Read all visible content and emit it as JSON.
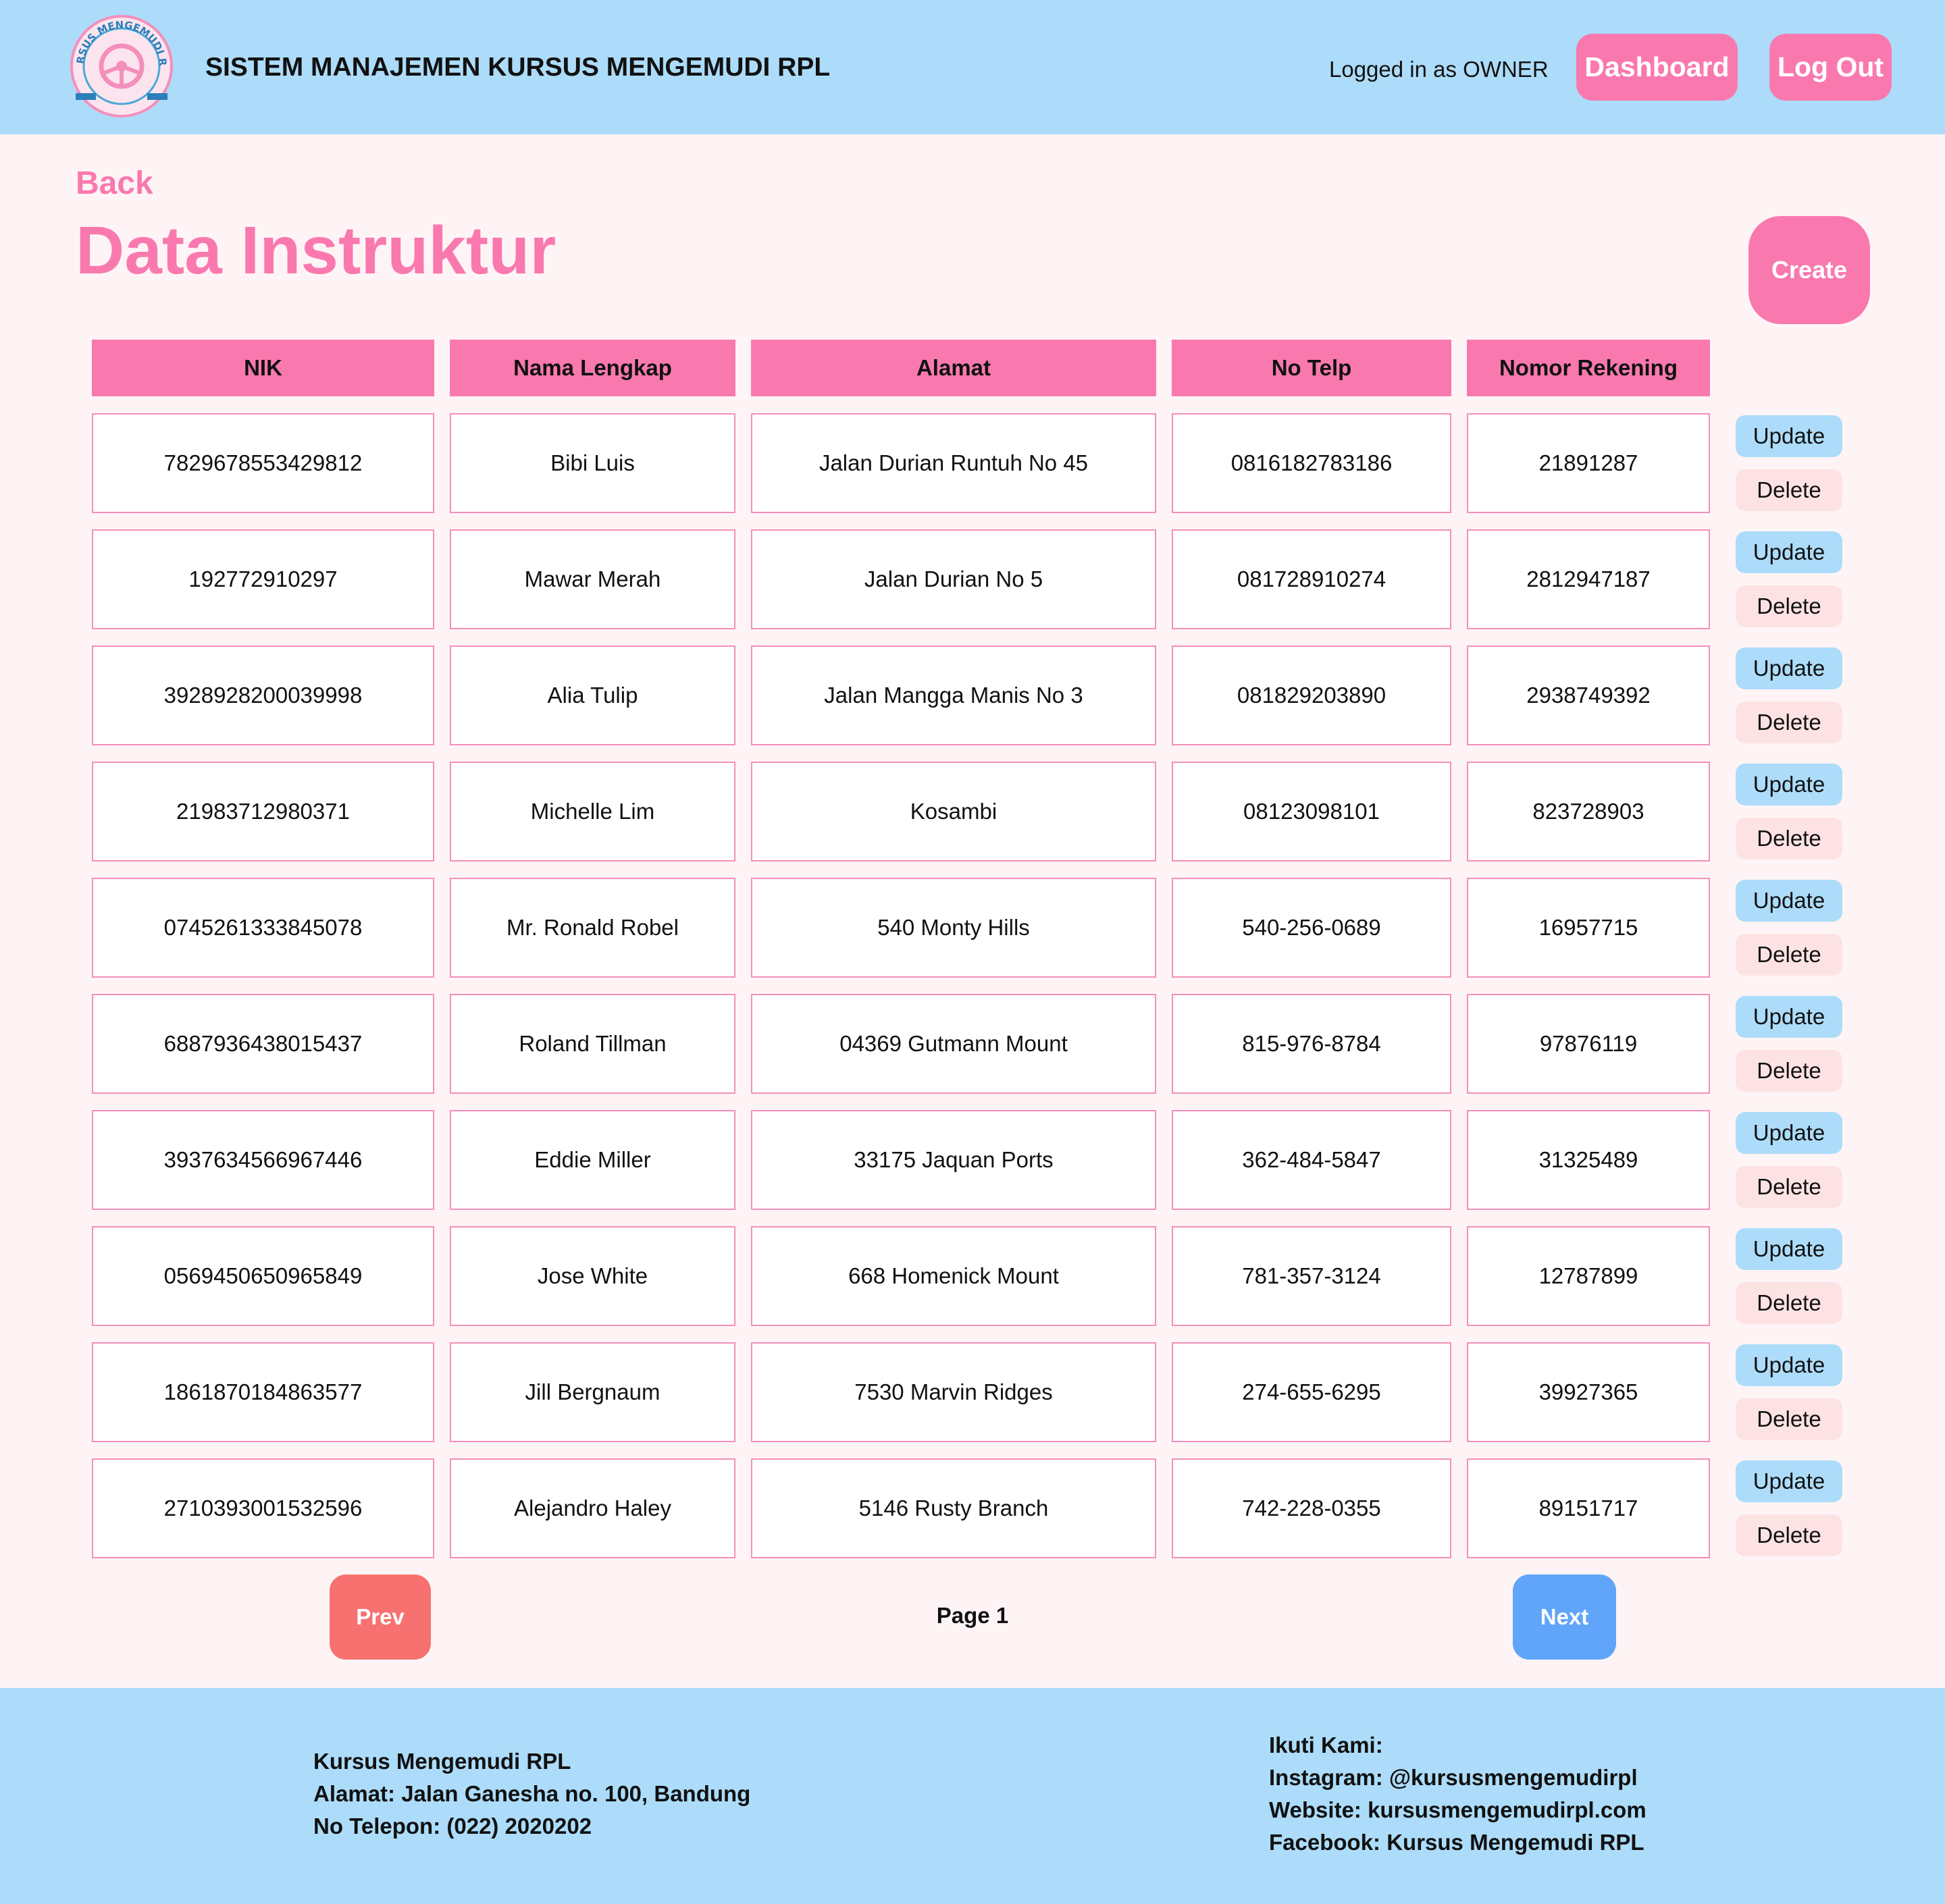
{
  "header": {
    "brand_title": "SISTEM MANAJEMEN KURSUS MENGEMUDI RPL",
    "logo_text": "KURSUS MENGEMUDI RPL",
    "logged_in_text": "Logged in as OWNER",
    "dashboard_label": "Dashboard",
    "logout_label": "Log Out"
  },
  "page": {
    "back_label": "Back",
    "title": "Data Instruktur",
    "create_label": "Create"
  },
  "table": {
    "columns": [
      "NIK",
      "Nama Lengkap",
      "Alamat",
      "No Telp",
      "Nomor Rekening"
    ],
    "update_label": "Update",
    "delete_label": "Delete",
    "rows": [
      [
        "7829678553429812",
        "Bibi Luis",
        "Jalan Durian Runtuh No 45",
        "0816182783186",
        "21891287"
      ],
      [
        "192772910297",
        "Mawar Merah",
        "Jalan Durian No 5",
        "081728910274",
        "2812947187"
      ],
      [
        "3928928200039998",
        "Alia Tulip",
        "Jalan Mangga Manis No 3",
        "081829203890",
        "2938749392"
      ],
      [
        "21983712980371",
        "Michelle Lim",
        "Kosambi",
        "08123098101",
        "823728903"
      ],
      [
        "0745261333845078",
        "Mr. Ronald Robel",
        "540 Monty Hills",
        "540-256-0689",
        "16957715"
      ],
      [
        "6887936438015437",
        "Roland Tillman",
        "04369 Gutmann Mount",
        "815-976-8784",
        "97876119"
      ],
      [
        "3937634566967446",
        "Eddie Miller",
        "33175 Jaquan Ports",
        "362-484-5847",
        "31325489"
      ],
      [
        "0569450650965849",
        "Jose White",
        "668 Homenick Mount",
        "781-357-3124",
        "12787899"
      ],
      [
        "1861870184863577",
        "Jill Bergnaum",
        "7530 Marvin Ridges",
        "274-655-6295",
        "39927365"
      ],
      [
        "2710393001532596",
        "Alejandro Haley",
        "5146 Rusty Branch",
        "742-228-0355",
        "89151717"
      ]
    ]
  },
  "pagination": {
    "prev_label": "Prev",
    "page_label": "Page 1",
    "next_label": "Next"
  },
  "footer": {
    "left": [
      "Kursus Mengemudi RPL",
      "Alamat: Jalan Ganesha no. 100, Bandung",
      "No Telepon: (022) 2020202"
    ],
    "right": [
      "Ikuti Kami:",
      "Instagram: @kursusmengemudirpl",
      "Website: kursusmengemudirpl.com",
      "Facebook: Kursus Mengemudi RPL"
    ]
  },
  "colors": {
    "header_bg": "#acdcfa",
    "accent_pink": "#f979af",
    "page_bg": "#fff4f5",
    "prev_red": "#f87171",
    "next_blue": "#60a5fa"
  }
}
